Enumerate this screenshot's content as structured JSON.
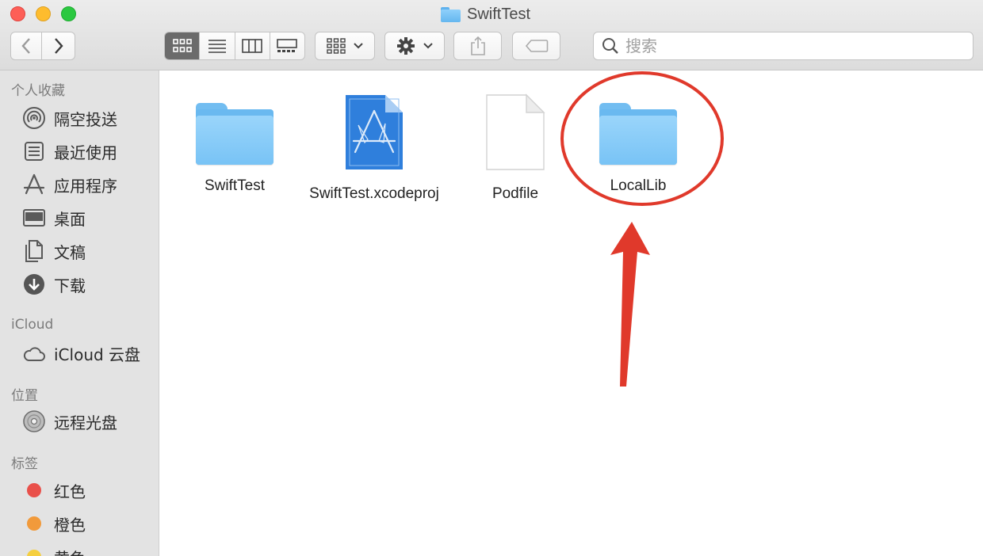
{
  "window": {
    "title": "SwiftTest"
  },
  "toolbar": {
    "search_placeholder": "搜索"
  },
  "sidebar": {
    "favorites_title": "个人收藏",
    "favorites": [
      {
        "label": "隔空投送",
        "icon": "airdrop-icon"
      },
      {
        "label": "最近使用",
        "icon": "recents-icon"
      },
      {
        "label": "应用程序",
        "icon": "applications-icon"
      },
      {
        "label": "桌面",
        "icon": "desktop-icon"
      },
      {
        "label": "文稿",
        "icon": "documents-icon"
      },
      {
        "label": "下载",
        "icon": "downloads-icon"
      }
    ],
    "icloud_title": "iCloud",
    "icloud": [
      {
        "label": "iCloud 云盘",
        "icon": "cloud-icon"
      }
    ],
    "locations_title": "位置",
    "locations": [
      {
        "label": "远程光盘",
        "icon": "disc-icon"
      }
    ],
    "tags_title": "标签",
    "tags": [
      {
        "label": "红色",
        "color": "#e9504a"
      },
      {
        "label": "橙色",
        "color": "#f19a3b"
      },
      {
        "label": "黄色",
        "color": "#f5cf3f"
      }
    ]
  },
  "files": [
    {
      "name": "SwiftTest",
      "kind": "folder-icon"
    },
    {
      "name": "SwiftTest.xcodeproj",
      "kind": "xcode-project-icon"
    },
    {
      "name": "Podfile",
      "kind": "document-icon"
    },
    {
      "name": "LocalLib",
      "kind": "folder-icon"
    }
  ],
  "annotation": {
    "color": "#e0392b"
  }
}
